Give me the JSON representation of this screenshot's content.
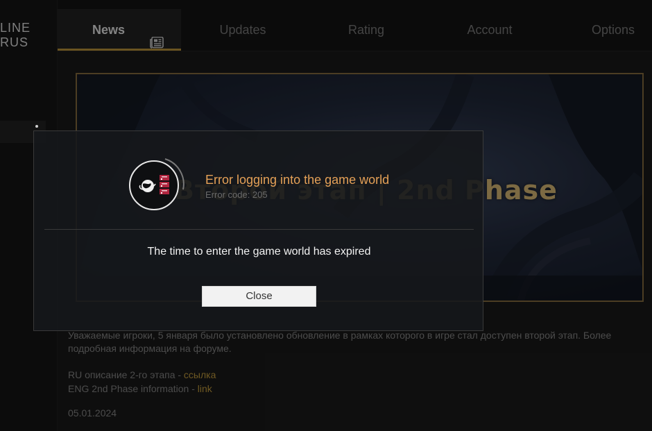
{
  "logo": {
    "line1": "LINE",
    "line2": "RUS"
  },
  "nav": {
    "tabs": [
      {
        "label": "News",
        "active": true,
        "icon": "newspaper-icon"
      },
      {
        "label": "Updates",
        "active": false
      },
      {
        "label": "Rating",
        "active": false
      },
      {
        "label": "Account",
        "active": false
      },
      {
        "label": "Options",
        "active": false
      }
    ]
  },
  "banner": {
    "title": "Второй этап | 2nd Phase"
  },
  "news": {
    "body": "Уважаемые игроки, 5 января было установлено обновление в рамках которого в игре стал доступен второй этап. Более подробная информация на форуме.",
    "ru_prefix": "RU описание 2-го этапа - ",
    "ru_link": "ссылка",
    "eng_prefix": "ENG 2nd Phase information - ",
    "eng_link": "link",
    "date": "05.01.2024"
  },
  "dialog": {
    "title": "Error logging into the game world",
    "code": "Error code: 205",
    "message": "The time to enter the game world has expired",
    "close_label": "Close",
    "icon": "globe-server-icon"
  },
  "colors": {
    "accent": "#c29a3c",
    "error_title": "#e5a157",
    "link": "#c9a13f"
  }
}
